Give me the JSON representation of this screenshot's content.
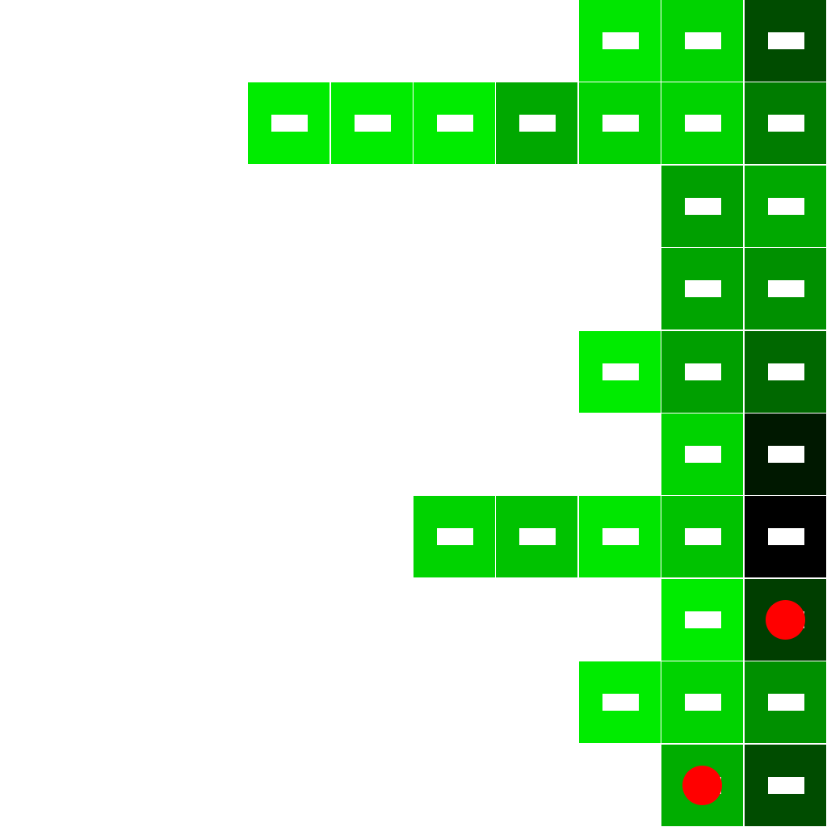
{
  "colors": {
    "background": "#ffffff",
    "slot": "#ffffff",
    "marker": "#ff0000"
  },
  "grid": {
    "columns": 10,
    "rows": 10,
    "cells": [
      {
        "row": 0,
        "col": 7,
        "color": "#00e600",
        "marker": false
      },
      {
        "row": 0,
        "col": 8,
        "color": "#00d300",
        "marker": false
      },
      {
        "row": 0,
        "col": 9,
        "color": "#004c00",
        "marker": false
      },
      {
        "row": 1,
        "col": 3,
        "color": "#00ec00",
        "marker": false
      },
      {
        "row": 1,
        "col": 4,
        "color": "#00ec00",
        "marker": false
      },
      {
        "row": 1,
        "col": 5,
        "color": "#00ec00",
        "marker": false
      },
      {
        "row": 1,
        "col": 6,
        "color": "#00a800",
        "marker": false
      },
      {
        "row": 1,
        "col": 7,
        "color": "#00d300",
        "marker": false
      },
      {
        "row": 1,
        "col": 8,
        "color": "#00d300",
        "marker": false
      },
      {
        "row": 1,
        "col": 9,
        "color": "#007c00",
        "marker": false
      },
      {
        "row": 2,
        "col": 8,
        "color": "#009f00",
        "marker": false
      },
      {
        "row": 2,
        "col": 9,
        "color": "#00a800",
        "marker": false
      },
      {
        "row": 3,
        "col": 8,
        "color": "#00a400",
        "marker": false
      },
      {
        "row": 3,
        "col": 9,
        "color": "#009000",
        "marker": false
      },
      {
        "row": 4,
        "col": 7,
        "color": "#00ec00",
        "marker": false
      },
      {
        "row": 4,
        "col": 8,
        "color": "#009f00",
        "marker": false
      },
      {
        "row": 4,
        "col": 9,
        "color": "#006800",
        "marker": false
      },
      {
        "row": 5,
        "col": 8,
        "color": "#00d300",
        "marker": false
      },
      {
        "row": 5,
        "col": 9,
        "color": "#001800",
        "marker": false
      },
      {
        "row": 6,
        "col": 5,
        "color": "#00d300",
        "marker": false
      },
      {
        "row": 6,
        "col": 6,
        "color": "#00c200",
        "marker": false
      },
      {
        "row": 6,
        "col": 7,
        "color": "#00e600",
        "marker": false
      },
      {
        "row": 6,
        "col": 8,
        "color": "#00c200",
        "marker": false
      },
      {
        "row": 6,
        "col": 9,
        "color": "#000000",
        "marker": false
      },
      {
        "row": 7,
        "col": 8,
        "color": "#00ec00",
        "marker": false
      },
      {
        "row": 7,
        "col": 9,
        "color": "#003e00",
        "marker": true
      },
      {
        "row": 8,
        "col": 7,
        "color": "#00ec00",
        "marker": false
      },
      {
        "row": 8,
        "col": 8,
        "color": "#00d300",
        "marker": false
      },
      {
        "row": 8,
        "col": 9,
        "color": "#009000",
        "marker": false
      },
      {
        "row": 9,
        "col": 8,
        "color": "#00ad00",
        "marker": true
      },
      {
        "row": 9,
        "col": 9,
        "color": "#004c00",
        "marker": false
      }
    ]
  }
}
